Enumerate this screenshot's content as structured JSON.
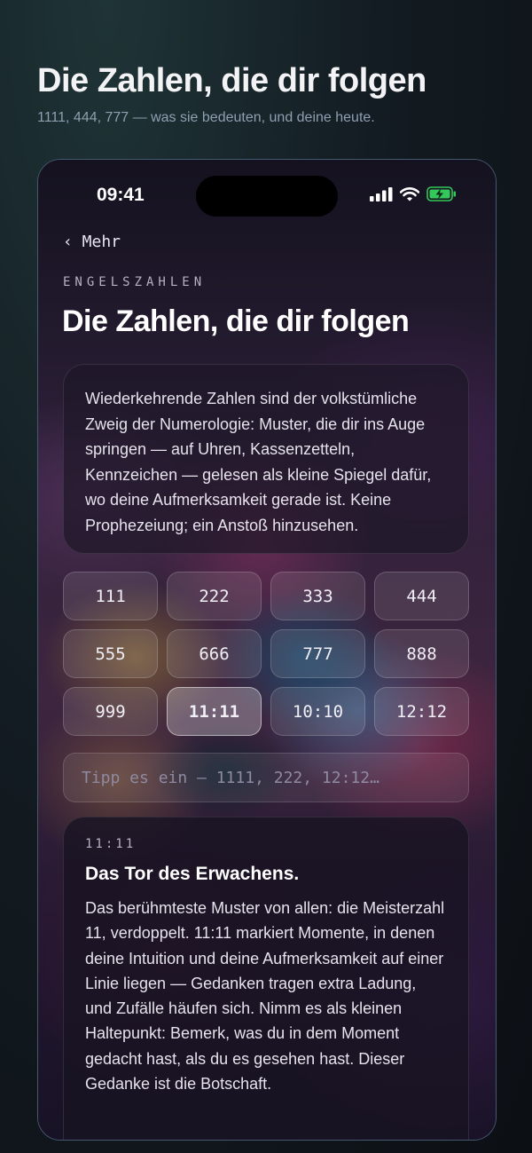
{
  "hero": {
    "title": "Die Zahlen, die dir folgen",
    "subtitle": "1111, 444, 777 — was sie bedeuten, und deine heute."
  },
  "status_bar": {
    "time": "09:41",
    "icons": [
      "signal-icon",
      "wifi-icon",
      "battery-charging-icon"
    ]
  },
  "nav": {
    "back_label": "‹ Mehr"
  },
  "page": {
    "eyebrow": "ENGELSZAHLEN",
    "title": "Die Zahlen, die dir folgen",
    "intro": "Wiederkehrende Zahlen sind der volkstümliche Zweig der Numerologie: Muster, die dir ins Auge springen — auf Uhren, Kassenzetteln, Kennzeichen — gelesen als kleine Spiegel dafür, wo deine Aufmerksamkeit gerade ist. Keine Prophezeiung; ein Anstoß hinzusehen."
  },
  "numbers": [
    "111",
    "222",
    "333",
    "444",
    "555",
    "666",
    "777",
    "888",
    "999",
    "11:11",
    "10:10",
    "12:12"
  ],
  "selected_number": "11:11",
  "search": {
    "placeholder": "Tipp es ein — 1111, 222, 12:12…",
    "value": ""
  },
  "detail": {
    "code": "11:11",
    "title": "Das Tor des Erwachens.",
    "body": "Das berühmteste Muster von allen: die Meisterzahl 11, verdoppelt. 11:11 markiert Momente, in denen deine Intuition und deine Aufmerksamkeit auf einer Linie liegen — Gedanken tragen extra Ladung, und Zufälle häufen sich. Nimm es als kleinen Haltepunkt: Bemerk, was du in dem Moment gedacht hast, als du es gesehen hast. Dieser Gedanke ist die Botschaft."
  },
  "colors": {
    "battery_charging": "#34c759",
    "accent_text": "#f2f2f5",
    "muted_text": "#8f9fb2"
  }
}
